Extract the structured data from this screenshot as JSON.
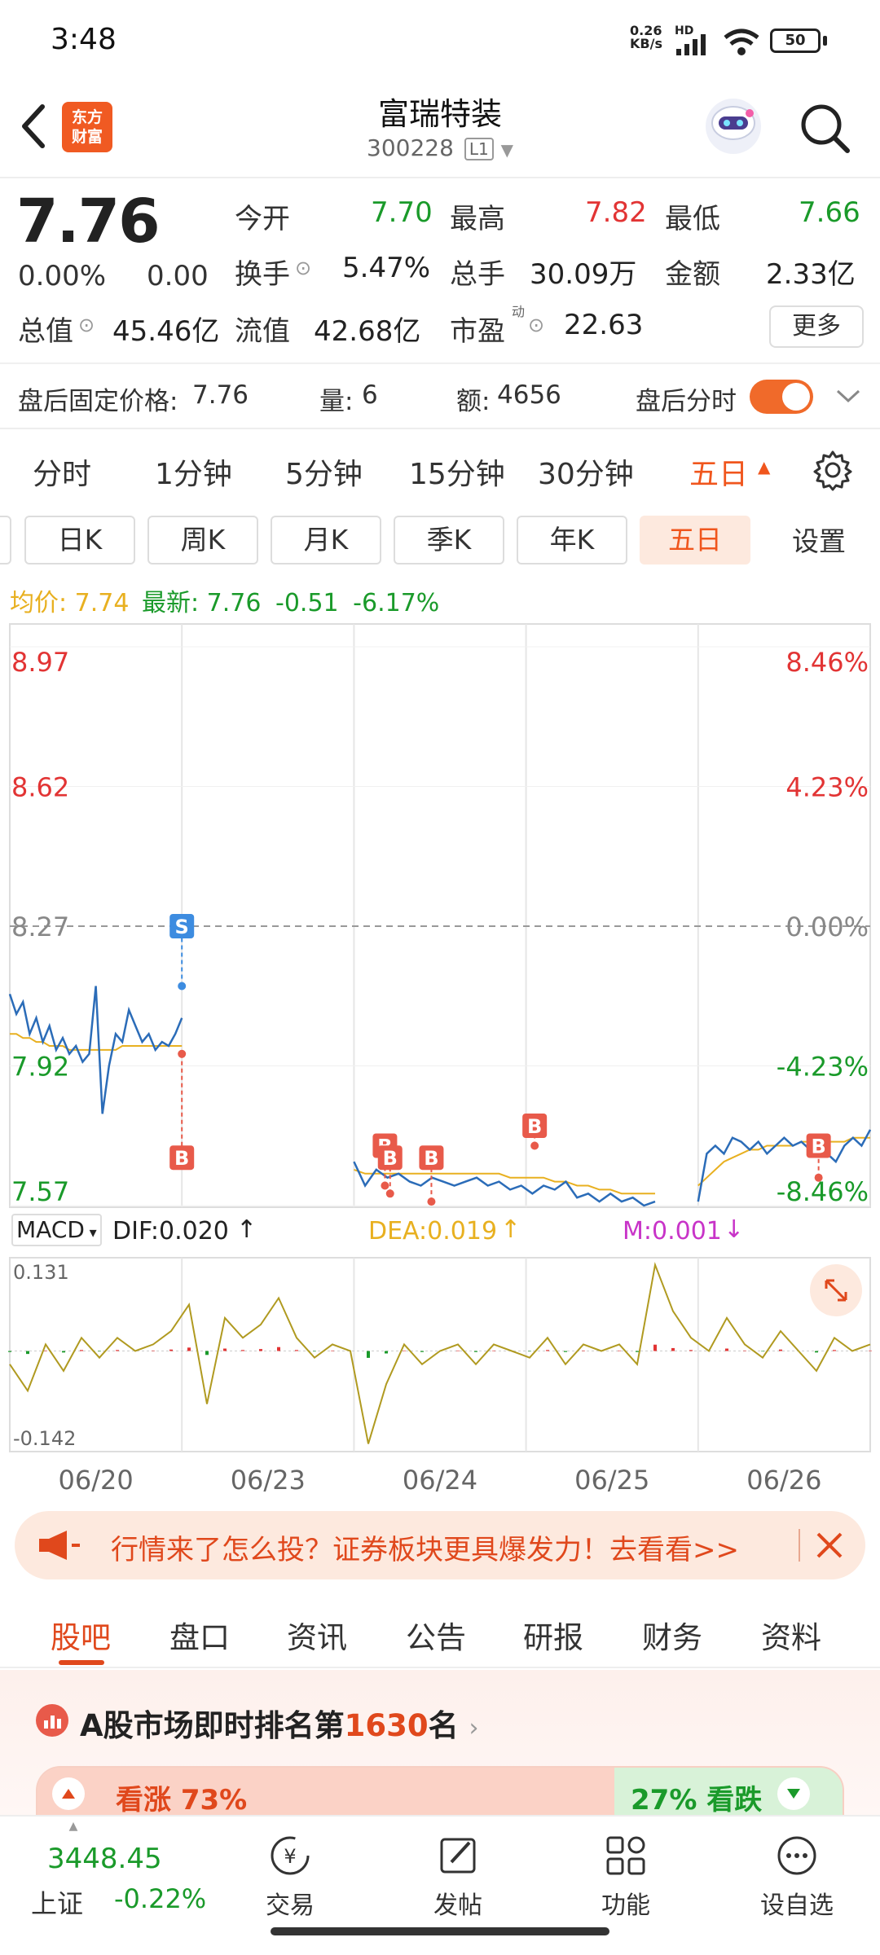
{
  "status_bar": {
    "time": "3:48",
    "net_speed": "0.26",
    "net_unit": "KB/s",
    "hd": "HD",
    "battery": "50"
  },
  "header": {
    "logo_line1": "东方",
    "logo_line2": "财富",
    "stock_name": "富瑞特装",
    "stock_code": "300228",
    "level": "L1"
  },
  "quote": {
    "price": "7.76",
    "change_pct": "0.00%",
    "change": "0.00",
    "open_label": "今开",
    "open": "7.70",
    "high_label": "最高",
    "high": "7.82",
    "low_label": "最低",
    "low": "7.66",
    "turnover_label": "换手",
    "turnover": "5.47%",
    "volume_label": "总手",
    "volume": "30.09万",
    "amount_label": "金额",
    "amount": "2.33亿",
    "mktcap_label": "总值",
    "mktcap": "45.46亿",
    "float_label": "流值",
    "float_cap": "42.68亿",
    "pe_label": "市盈",
    "pe_sup": "动",
    "pe": "22.63",
    "more_button": "更多"
  },
  "after_hours": {
    "price_label": "盘后固定价格:",
    "price": "7.76",
    "qty_label": "量:",
    "qty": "6",
    "amt_label": "额:",
    "amt": "4656",
    "toggle_label": "盘后分时",
    "toggle_on": true
  },
  "period_tabs": [
    "分时",
    "1分钟",
    "5分钟",
    "15分钟",
    "30分钟",
    "五日"
  ],
  "period_active": "五日",
  "k_tabs": [
    "日K",
    "周K",
    "月K",
    "季K",
    "年K",
    "五日",
    "设置"
  ],
  "k_active": "五日",
  "legend": {
    "avg_label": "均价:",
    "avg": "7.74",
    "latest_label": "最新:",
    "latest": "7.76",
    "chg": "-0.51",
    "chg_pct": "-6.17%"
  },
  "chart_data": {
    "type": "line",
    "price_axis": [
      "8.97",
      "8.62",
      "8.27",
      "7.92",
      "7.57"
    ],
    "pct_axis": [
      "8.46%",
      "4.23%",
      "0.00%",
      "-4.23%",
      "-8.46%"
    ],
    "prev_close": 8.27,
    "ylim": [
      7.57,
      8.97
    ],
    "dates": [
      "06/20",
      "06/23",
      "06/24",
      "06/25",
      "06/26"
    ],
    "price_series": [
      [
        8.1,
        8.05,
        8.08,
        8.0,
        8.04,
        7.98,
        8.02,
        7.96,
        7.99,
        7.95,
        7.97,
        7.93,
        7.95,
        8.12,
        7.8,
        7.92,
        8.0,
        7.98,
        8.06,
        8.02,
        7.98,
        8.0,
        7.96,
        7.98,
        7.97,
        8.0,
        8.04
      ],
      [
        7.68,
        7.62,
        7.66,
        7.64,
        7.65,
        7.63,
        7.62,
        7.64,
        7.63,
        7.62,
        7.63,
        7.64,
        7.62,
        7.63,
        7.61,
        7.62,
        7.6,
        7.62,
        7.61,
        7.63,
        7.59,
        7.6,
        7.58,
        7.6,
        7.58,
        7.59,
        7.57,
        7.58
      ],
      [
        7.58,
        7.7,
        7.72,
        7.7,
        7.74,
        7.73,
        7.71,
        7.73,
        7.7,
        7.72,
        7.74,
        7.72,
        7.73,
        7.71,
        7.73,
        7.7,
        7.68,
        7.72,
        7.74,
        7.72,
        7.76
      ]
    ],
    "avg_series": [
      [
        8.0,
        8.0,
        7.99,
        7.99,
        7.98,
        7.98,
        7.97,
        7.97,
        7.97,
        7.96,
        7.96,
        7.96,
        7.96,
        7.96,
        7.96,
        7.96,
        7.96,
        7.97,
        7.97,
        7.97,
        7.97,
        7.97,
        7.97,
        7.97,
        7.97,
        7.97,
        7.97
      ],
      [
        7.66,
        7.65,
        7.65,
        7.65,
        7.65,
        7.65,
        7.65,
        7.65,
        7.65,
        7.65,
        7.65,
        7.65,
        7.65,
        7.65,
        7.64,
        7.64,
        7.64,
        7.64,
        7.63,
        7.63,
        7.62,
        7.62,
        7.61,
        7.61,
        7.6,
        7.6,
        7.6,
        7.6
      ],
      [
        7.62,
        7.64,
        7.66,
        7.68,
        7.69,
        7.7,
        7.71,
        7.71,
        7.72,
        7.72,
        7.72,
        7.72,
        7.73,
        7.73,
        7.73,
        7.73,
        7.73,
        7.73,
        7.74,
        7.74,
        7.74
      ]
    ],
    "markers": [
      {
        "label": "S",
        "day": 1,
        "pos": 0.0,
        "price": 8.27,
        "at": 8.12
      },
      {
        "label": "B",
        "day": 1,
        "pos": 0.0,
        "price": 7.69,
        "at": 7.95
      },
      {
        "label": "B",
        "day": 2,
        "pos": 0.18,
        "price": 7.72,
        "at": 7.62
      },
      {
        "label": "B",
        "day": 2,
        "pos": 0.21,
        "price": 7.69,
        "at": 7.6
      },
      {
        "label": "B",
        "day": 2,
        "pos": 0.45,
        "price": 7.69,
        "at": 7.58
      },
      {
        "label": "B",
        "day": 3,
        "pos": 0.05,
        "price": 7.77,
        "at": 7.72
      },
      {
        "label": "B",
        "day": 4,
        "pos": 0.7,
        "price": 7.72,
        "at": 7.64
      }
    ],
    "macd": {
      "selector": "MACD",
      "dif_label": "DIF:0.020",
      "dea_label": "DEA:0.019",
      "m_label": "M:0.001",
      "ymax": "0.131",
      "ymin": "-0.142",
      "series": [
        -0.02,
        -0.06,
        0.01,
        -0.03,
        0.02,
        -0.01,
        0.02,
        0.0,
        0.01,
        0.03,
        0.07,
        -0.08,
        0.05,
        0.02,
        0.04,
        0.08,
        0.02,
        -0.01,
        0.01,
        0.0,
        -0.14,
        -0.05,
        0.01,
        -0.02,
        0.0,
        0.01,
        -0.02,
        0.01,
        0.0,
        -0.01,
        0.02,
        -0.02,
        0.01,
        0.0,
        0.01,
        -0.02,
        0.13,
        0.06,
        0.02,
        0.0,
        0.05,
        0.01,
        -0.01,
        0.03,
        0.0,
        -0.03,
        0.02,
        0.0,
        0.01
      ]
    }
  },
  "banner": {
    "text": "行情来了怎么投？证券板块更具爆发力！去看看>>"
  },
  "sub_tabs": [
    "股吧",
    "盘口",
    "资讯",
    "公告",
    "研报",
    "财务",
    "资料"
  ],
  "sub_active": "股吧",
  "rank": {
    "prefix": "A股市场即时排名第",
    "rank": "1630",
    "suffix": "名",
    "up_label": "看涨 73%",
    "down_label": "27% 看跌"
  },
  "bottom_bar": {
    "index_value": "3448.45",
    "index_name": "上证",
    "index_chg": "-0.22%",
    "items": [
      "交易",
      "发帖",
      "功能",
      "设自选"
    ]
  }
}
